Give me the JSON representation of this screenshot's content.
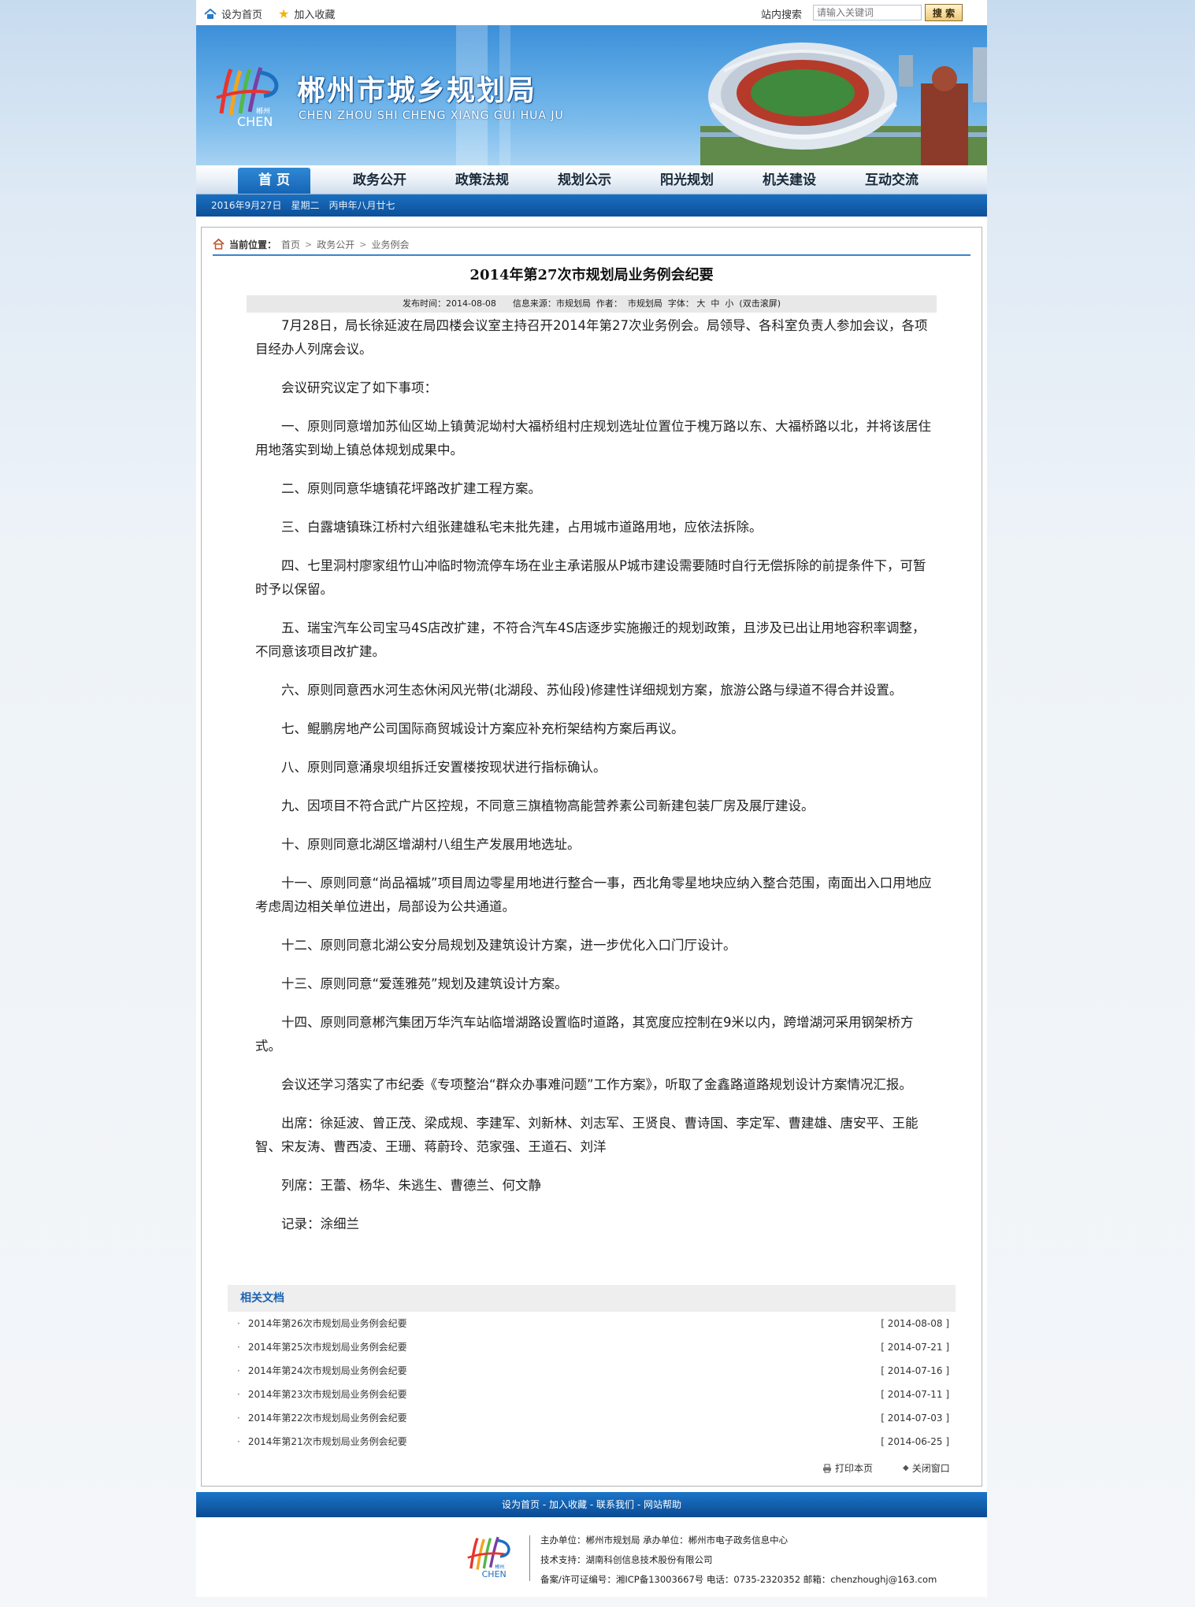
{
  "topbar": {
    "home_label": "设为首页",
    "fav_label": "加入收藏",
    "search_label": "站内搜索",
    "search_placeholder": "请输入关键词",
    "search_button": "搜 索"
  },
  "banner": {
    "logo_text": "郴州 CHEN",
    "title": "郴州市城乡规划局",
    "subtitle": "CHEN ZHOU SHI CHENG XIANG GUI HUA JU"
  },
  "nav": {
    "items": [
      "首 页",
      "政务公开",
      "政策法规",
      "规划公示",
      "阳光规划",
      "机关建设",
      "互动交流"
    ]
  },
  "datebar": {
    "text": "2016年9月27日　星期二　丙申年八月廿七"
  },
  "breadcrumb": {
    "label": "当前位置：",
    "items": [
      "首页",
      "政务公开",
      "业务例会"
    ]
  },
  "article": {
    "title": "2014年第27次市规划局业务例会纪要",
    "meta": {
      "published_label": "发布时间：",
      "published": "2014-08-08",
      "source_label": "信息来源：",
      "source": "市规划局",
      "author_label": "作者：",
      "author": "市规划局",
      "font_label": "字体：",
      "font_large": "大",
      "font_medium": "中",
      "font_small": "小",
      "scroll": "(双击滚屏)"
    },
    "paragraphs": [
      "7月28日，局长徐延波在局四楼会议室主持召开2014年第27次业务例会。局领导、各科室负责人参加会议，各项目经办人列席会议。",
      "会议研究议定了如下事项：",
      "一、原则同意增加苏仙区坳上镇黄泥坳村大福桥组村庄规划选址位置位于槐万路以东、大福桥路以北，并将该居住用地落实到坳上镇总体规划成果中。",
      "二、原则同意华塘镇花坪路改扩建工程方案。",
      "三、白露塘镇珠江桥村六组张建雄私宅未批先建，占用城市道路用地，应依法拆除。",
      "四、七里洞村廖家组竹山冲临时物流停车场在业主承诺服从P城市建设需要随时自行无偿拆除的前提条件下，可暂时予以保留。",
      "五、瑞宝汽车公司宝马4S店改扩建，不符合汽车4S店逐步实施搬迁的规划政策，且涉及已出让用地容积率调整，不同意该项目改扩建。",
      "六、原则同意西水河生态休闲风光带(北湖段、苏仙段)修建性详细规划方案，旅游公路与绿道不得合并设置。",
      "七、鲲鹏房地产公司国际商贸城设计方案应补充桁架结构方案后再议。",
      "八、原则同意涌泉坝组拆迁安置楼按现状进行指标确认。",
      "九、因项目不符合武广片区控规，不同意三旗植物高能营养素公司新建包装厂房及展厅建设。",
      "十、原则同意北湖区增湖村八组生产发展用地选址。",
      "十一、原则同意“尚品福城”项目周边零星用地进行整合一事，西北角零星地块应纳入整合范围，南面出入口用地应考虑周边相关单位进出，局部设为公共通道。",
      "十二、原则同意北湖公安分局规划及建筑设计方案，进一步优化入口门厅设计。",
      "十三、原则同意“爱莲雅苑”规划及建筑设计方案。",
      "十四、原则同意郴汽集团万华汽车站临增湖路设置临时道路，其宽度应控制在9米以内，跨增湖河采用钢架桥方式。",
      "会议还学习落实了市纪委《专项整治“群众办事难问题”工作方案》，听取了金鑫路道路规划设计方案情况汇报。",
      "出席：徐延波、曾正茂、梁成规、李建军、刘新林、刘志军、王贤良、曹诗国、李定军、曹建雄、唐安平、王能智、宋友涛、曹西凌、王珊、蒋蔚玲、范家强、王道石、刘洋",
      "列席：王蕾、杨华、朱逃生、曹德兰、何文静",
      "记录：涂细兰"
    ]
  },
  "related": {
    "heading": "相关文档",
    "items": [
      {
        "title": "2014年第26次市规划局业务例会纪要",
        "date": "[ 2014-08-08 ]"
      },
      {
        "title": "2014年第25次市规划局业务例会纪要",
        "date": "[ 2014-07-21 ]"
      },
      {
        "title": "2014年第24次市规划局业务例会纪要",
        "date": "[ 2014-07-16 ]"
      },
      {
        "title": "2014年第23次市规划局业务例会纪要",
        "date": "[ 2014-07-11 ]"
      },
      {
        "title": "2014年第22次市规划局业务例会纪要",
        "date": "[ 2014-07-03 ]"
      },
      {
        "title": "2014年第21次市规划局业务例会纪要",
        "date": "[ 2014-06-25 ]"
      }
    ]
  },
  "actions": {
    "print": "打印本页",
    "close": "关闭窗口"
  },
  "footer": {
    "links": [
      "设为首页",
      "加入收藏",
      "联系我们",
      "网站帮助"
    ],
    "separator": " - ",
    "line1": "主办单位：郴州市规划局  承办单位：郴州市电子政务信息中心",
    "line2": "技术支持：湖南科创信息技术股份有限公司",
    "line3": "备案/许可证编号：湘ICP备13003667号 电话：0735-2320352 邮箱：chenzhoughj@163.com"
  },
  "colors": {
    "nav_active": "#1f73c2",
    "datebar": "#0f58a5",
    "breadcrumb_rule": "#3a85c8",
    "related_heading": "#1a63b3"
  }
}
